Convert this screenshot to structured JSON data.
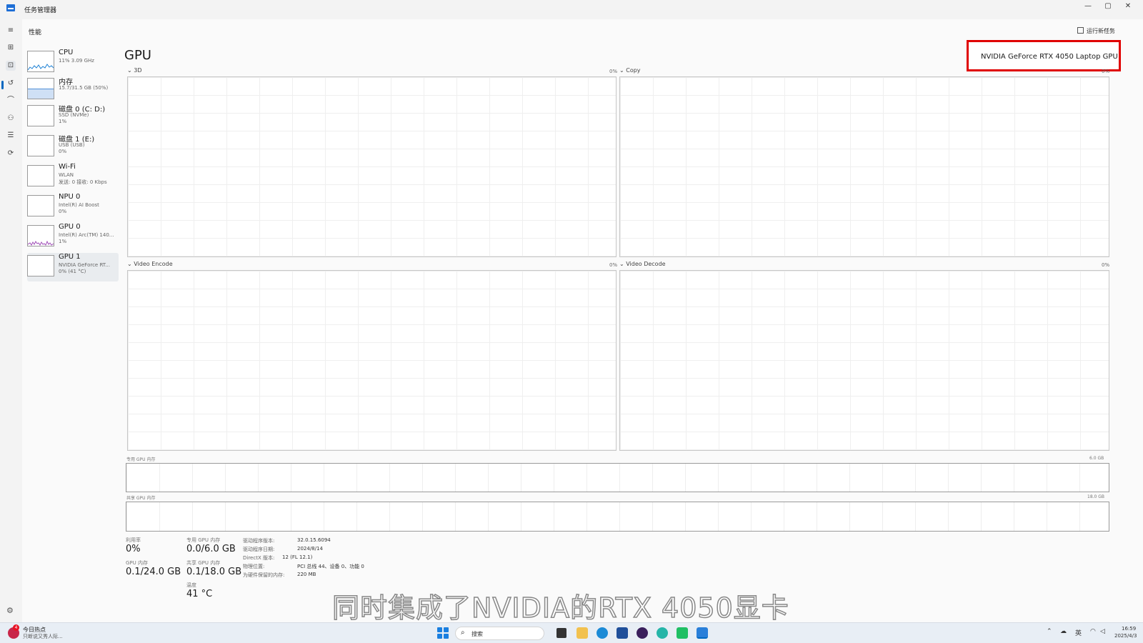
{
  "window": {
    "title": "任务管理器"
  },
  "window_controls": {
    "minimize": "—",
    "maximize": "▢",
    "close": "✕"
  },
  "rail": {
    "items": [
      {
        "icon": "hamburger-menu-icon",
        "glyph": "≡"
      },
      {
        "icon": "processes-icon",
        "glyph": "⊞"
      },
      {
        "icon": "performance-icon",
        "glyph": "⊡"
      },
      {
        "icon": "app-history-icon",
        "glyph": "↺"
      },
      {
        "icon": "startup-apps-icon",
        "glyph": "⌒"
      },
      {
        "icon": "users-icon",
        "glyph": "⚇"
      },
      {
        "icon": "details-icon",
        "glyph": "☰"
      },
      {
        "icon": "services-icon",
        "glyph": "⟳"
      }
    ],
    "settings_glyph": "⚙"
  },
  "header": {
    "section": "性能",
    "run_task": "运行新任务",
    "more": "···"
  },
  "devices": [
    {
      "name": "CPU",
      "sub1": "11% 3.09 GHz",
      "sub2": ""
    },
    {
      "name": "内存",
      "sub1": "15.7/31.5 GB (50%)",
      "sub2": ""
    },
    {
      "name": "磁盘 0 (C: D:)",
      "sub1": "SSD (NVMe)",
      "sub2": "1%"
    },
    {
      "name": "磁盘 1 (E:)",
      "sub1": "USB (USB)",
      "sub2": "0%"
    },
    {
      "name": "Wi-Fi",
      "sub1": "WLAN",
      "sub2": "发送: 0 接收: 0 Kbps"
    },
    {
      "name": "NPU 0",
      "sub1": "Intel(R) AI Boost",
      "sub2": "0%"
    },
    {
      "name": "GPU 0",
      "sub1": "Intel(R) Arc(TM) 140...",
      "sub2": "1%"
    },
    {
      "name": "GPU 1",
      "sub1": "NVIDIA GeForce RT...",
      "sub2": "0% (41 °C)"
    }
  ],
  "gpu": {
    "title": "GPU",
    "model": "NVIDIA GeForce RTX 4050 Laptop GPU",
    "engines": [
      {
        "label": "⌄ 3D",
        "value": "0%"
      },
      {
        "label": "⌄ Copy",
        "value": "0%"
      },
      {
        "label": "⌄ Video Encode",
        "value": "0%"
      },
      {
        "label": "⌄ Video Decode",
        "value": "0%"
      }
    ],
    "dedicated_mem": {
      "label": "专用 GPU 内存",
      "max": "6.0 GB"
    },
    "shared_mem": {
      "label": "共享 GPU 内存",
      "max": "18.0 GB"
    }
  },
  "stats": {
    "utilization": {
      "label": "利用率",
      "value": "0%"
    },
    "dedicated": {
      "label": "专用 GPU 内存",
      "value": "0.0/6.0 GB"
    },
    "gpu_memory": {
      "label": "GPU 内存",
      "value": "0.1/24.0 GB"
    },
    "shared": {
      "label": "共享 GPU 内存",
      "value": "0.1/18.0 GB"
    },
    "temperature": {
      "label": "温度",
      "value": "41 °C"
    }
  },
  "properties": [
    {
      "key": "驱动程序版本:",
      "value": "32.0.15.6094"
    },
    {
      "key": "驱动程序日期:",
      "value": "2024/8/14"
    },
    {
      "key": "DirectX 版本:",
      "value": "12 (FL 12.1)"
    },
    {
      "key": "物理位置:",
      "value": "PCI 总线 44、设备 0、功能 0"
    },
    {
      "key": "为硬件保留的内存:",
      "value": "220 MB"
    }
  ],
  "subtitle": "同时集成了NVIDIA的RTX 4050显卡",
  "taskbar": {
    "news_title": "今日热点",
    "news_sub": "只断说又秀人际...",
    "news_count": "4",
    "search_placeholder": "搜索",
    "search_glyph": "⌕",
    "time": "16:59",
    "date": "2025/4/3",
    "ime": "英",
    "tray_up": "⌃",
    "wifi": "◠",
    "volume": "◁",
    "onedrive": "☁"
  },
  "colors": {
    "accent": "#0067c0",
    "highlight_box": "#e00000",
    "gpu0_graph": "#a04fb8",
    "cpu_graph": "#1a7fd4",
    "mem_graph": "#4f8fd8"
  }
}
